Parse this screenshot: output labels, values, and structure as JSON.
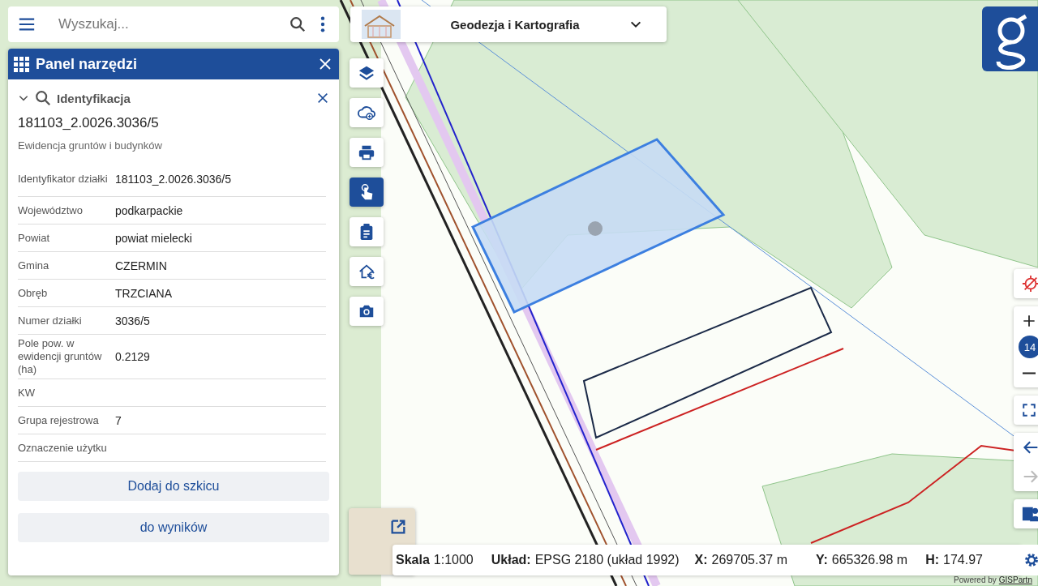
{
  "search": {
    "placeholder": "Wyszukaj..."
  },
  "panel": {
    "title": "Panel narzędzi",
    "section": {
      "title": "Identyfikacja",
      "expanded": true
    },
    "parcel_id": "181103_2.0026.3036/5",
    "subtitle": "Ewidencja gruntów i budynków",
    "attributes": [
      {
        "label": "Identyfikator działki",
        "value": "181103_2.0026.3036/5"
      },
      {
        "label": "Województwo",
        "value": "podkarpackie"
      },
      {
        "label": "Powiat",
        "value": "powiat mielecki"
      },
      {
        "label": "Gmina",
        "value": "CZERMIN"
      },
      {
        "label": "Obręb",
        "value": "TRZCIANA"
      },
      {
        "label": "Numer działki",
        "value": "3036/5"
      },
      {
        "label": "Pole pow. w ewidencji gruntów (ha)",
        "value": "0.2129"
      },
      {
        "label": "KW"
      },
      {
        "label": "Grupa rejestrowa",
        "value": "7"
      },
      {
        "label": "Oznaczenie użytku"
      }
    ],
    "buttons": [
      "Dodaj do szkicu",
      "do wyników"
    ]
  },
  "topbar": {
    "title": "Geodezja i Kartografia"
  },
  "tools": [
    {
      "selected": false
    },
    {
      "selected": false
    },
    {
      "selected": false
    },
    {
      "selected": true
    },
    {
      "selected": false
    },
    {
      "selected": false
    },
    {
      "selected": false
    }
  ],
  "zoom": {
    "level": "14"
  },
  "history": [
    {
      "disabled": false
    },
    {
      "disabled": true
    }
  ],
  "status_bar": [
    {
      "label": "Skala",
      "value": "1:1000"
    },
    {
      "label": "Układ:",
      "value": "EPSG 2180 (układ 1992)"
    },
    {
      "label": "X:",
      "value": "269705.37 m"
    },
    {
      "label": "Y:",
      "value": "665326.98 m"
    },
    {
      "label": "H:",
      "value": "174.97"
    }
  ],
  "attribution": {
    "prefix": "Powered by",
    "link": "GISPartn"
  }
}
